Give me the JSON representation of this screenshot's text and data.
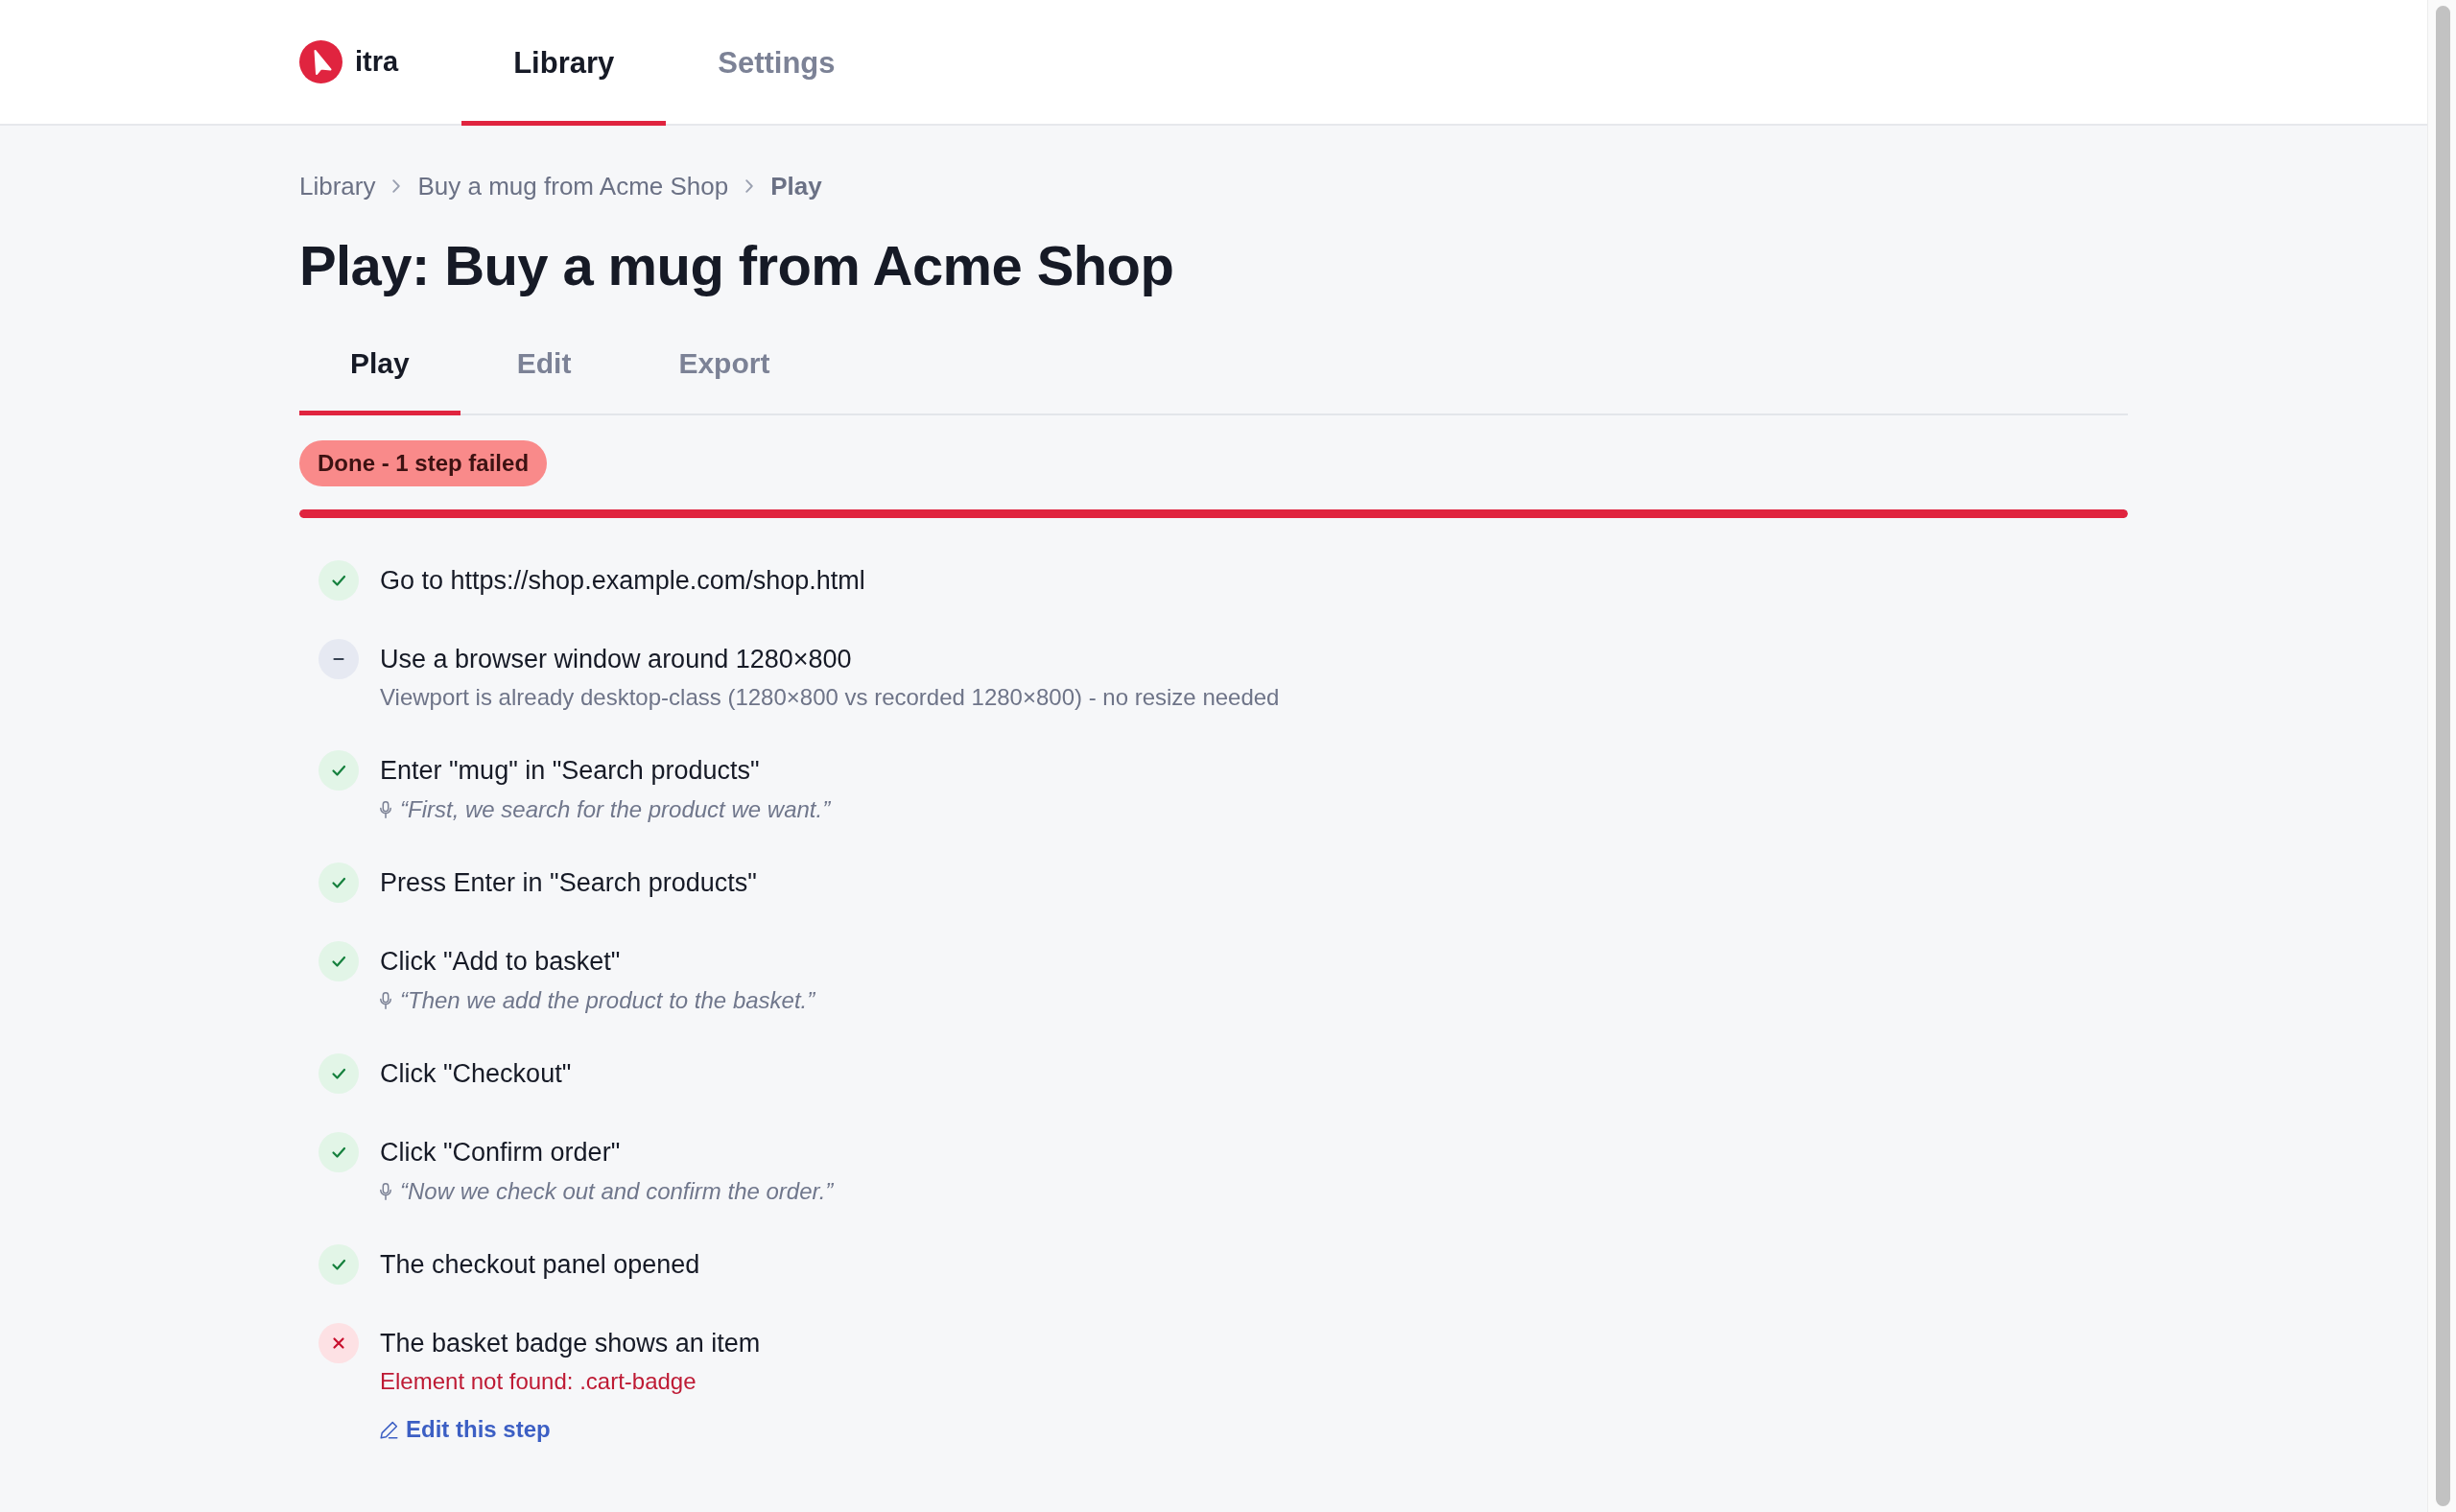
{
  "app": {
    "name": "itra"
  },
  "nav_tabs": [
    {
      "label": "Library",
      "selected": true
    },
    {
      "label": "Settings",
      "selected": false
    }
  ],
  "breadcrumb": [
    {
      "label": "Library",
      "current": false
    },
    {
      "label": "Buy a mug from Acme Shop",
      "current": false
    },
    {
      "label": "Play",
      "current": true
    }
  ],
  "page_title": "Play: Buy a mug from Acme Shop",
  "tabs": [
    {
      "label": "Play",
      "selected": true
    },
    {
      "label": "Edit",
      "selected": false
    },
    {
      "label": "Export",
      "selected": false
    }
  ],
  "run_status": {
    "label": "Done - 1 step failed",
    "failed": true
  },
  "progress": {
    "level": 1
  },
  "steps": [
    {
      "kind": "passed",
      "title": "Go to https://shop.example.com/shop.html"
    },
    {
      "kind": "skipped",
      "title": "Use a browser window around 1280×800",
      "note": "Viewport is already desktop-class (1280×800 vs recorded 1280×800) - no resize needed"
    },
    {
      "kind": "passed",
      "title": "Enter \"mug\" in \"Search products\"",
      "narration": "“First, we search for the product we want.”"
    },
    {
      "kind": "passed",
      "title": "Press Enter in \"Search products\""
    },
    {
      "kind": "passed",
      "title": "Click \"Add to basket\"",
      "narration": "“Then we add the product to the basket.”"
    },
    {
      "kind": "passed",
      "title": "Click \"Checkout\""
    },
    {
      "kind": "passed",
      "title": "Click \"Confirm order\"",
      "narration": "“Now we check out and confirm the order.”"
    },
    {
      "kind": "passed",
      "title": "The checkout panel opened"
    },
    {
      "kind": "failed",
      "title": "The basket badge shows an item",
      "error": "Element not found: .cart-badge",
      "action": "Edit this step"
    }
  ]
}
